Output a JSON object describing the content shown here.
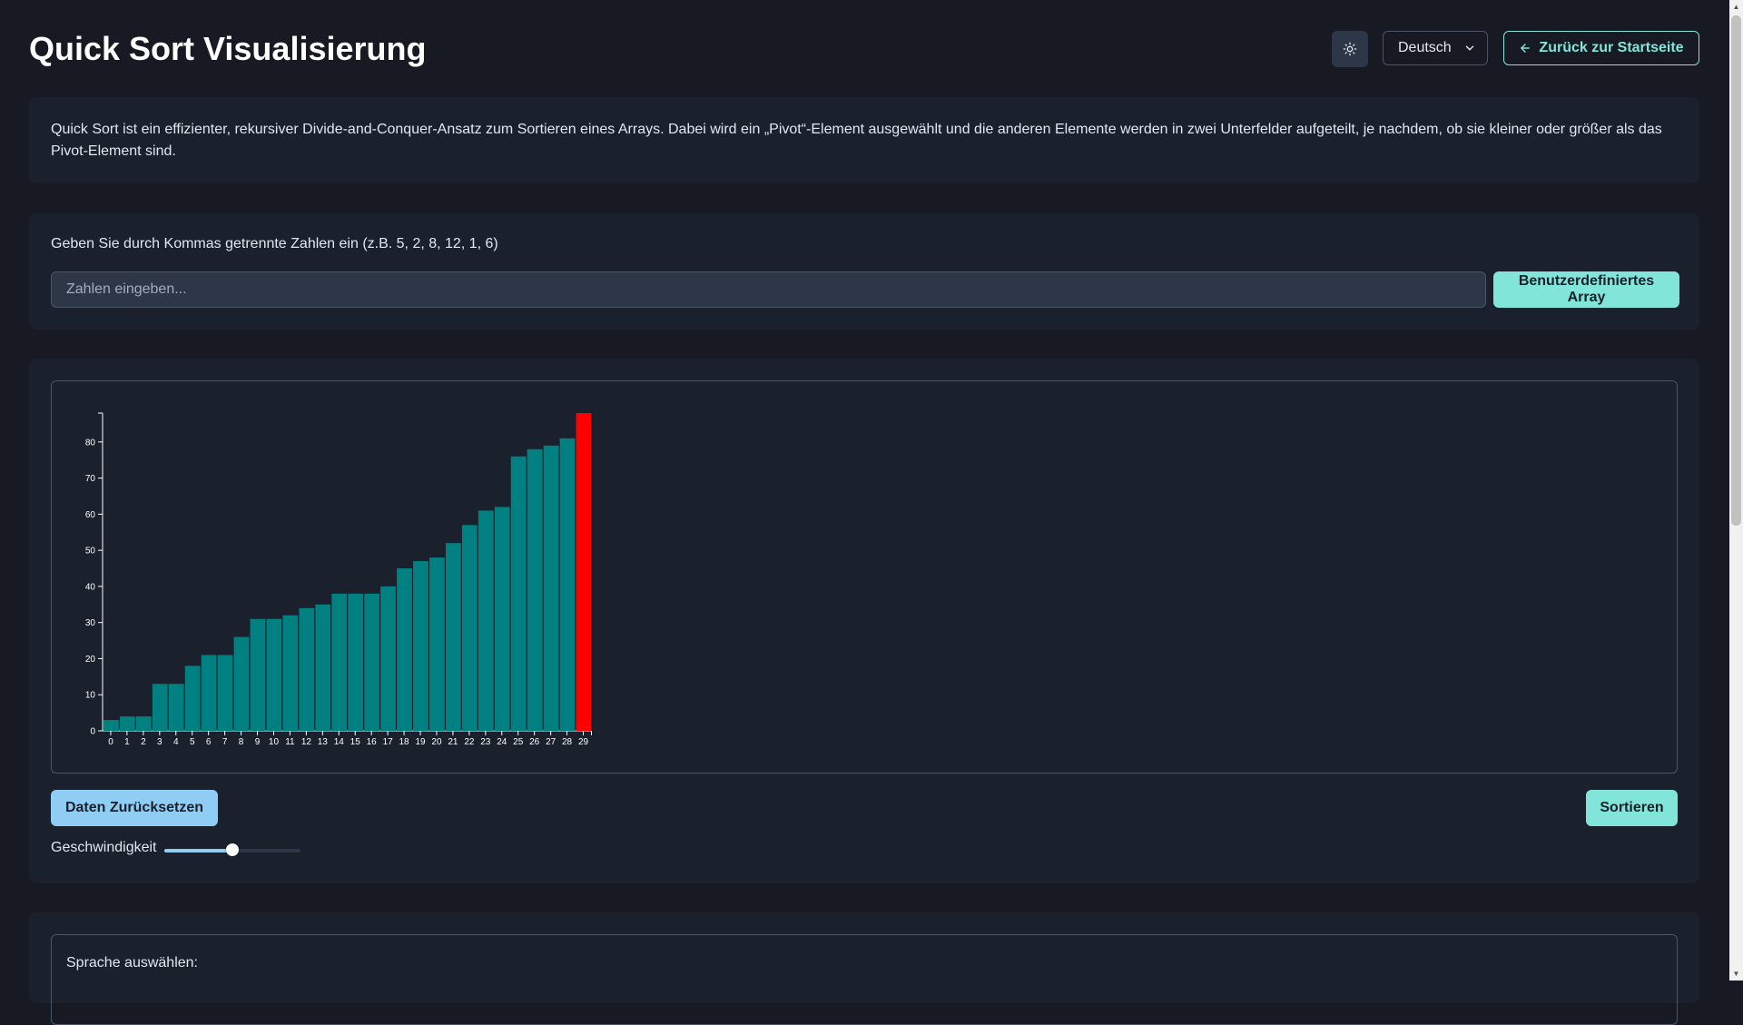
{
  "header": {
    "title": "Quick Sort Visualisierung",
    "theme_icon": "sun-icon",
    "language_value": "Deutsch",
    "back_label": "Zurück zur Startseite"
  },
  "description": {
    "text": "Quick Sort ist ein effizienter, rekursiver Divide-and-Conquer-Ansatz zum Sortieren eines Arrays. Dabei wird ein „Pivot“-Element ausgewählt und die anderen Elemente werden in zwei Unterfelder aufgeteilt, je nachdem, ob sie kleiner oder größer als das Pivot-Element sind."
  },
  "input": {
    "label": "Geben Sie durch Kommas getrennte Zahlen ein (z.B. 5, 2, 8, 12, 1, 6)",
    "value": "",
    "placeholder": "Zahlen eingeben...",
    "button_label": "Benutzerdefiniertes Array"
  },
  "controls": {
    "reset_label": "Daten Zurücksetzen",
    "sort_label": "Sortieren",
    "speed_label": "Geschwindigkeit",
    "speed_value": 0.5
  },
  "language_section": {
    "label": "Sprache auswählen:"
  },
  "colors": {
    "bar": "#008080",
    "pivot": "#ff0000",
    "accent": "#81e6d9",
    "reset": "#90cdf4"
  },
  "chart_data": {
    "type": "bar",
    "categories": [
      "0",
      "1",
      "2",
      "3",
      "4",
      "5",
      "6",
      "7",
      "8",
      "9",
      "10",
      "11",
      "12",
      "13",
      "14",
      "15",
      "16",
      "17",
      "18",
      "19",
      "20",
      "21",
      "22",
      "23",
      "24",
      "25",
      "26",
      "27",
      "28",
      "29"
    ],
    "values": [
      3,
      4,
      4,
      13,
      13,
      18,
      21,
      21,
      26,
      31,
      31,
      32,
      34,
      35,
      38,
      38,
      38,
      40,
      45,
      47,
      48,
      52,
      57,
      61,
      62,
      76,
      78,
      79,
      81,
      88
    ],
    "highlight_index": 29,
    "yticks": [
      0,
      10,
      20,
      30,
      40,
      50,
      60,
      70,
      80
    ],
    "ylim": [
      0,
      88
    ],
    "title": "",
    "xlabel": "",
    "ylabel": ""
  }
}
